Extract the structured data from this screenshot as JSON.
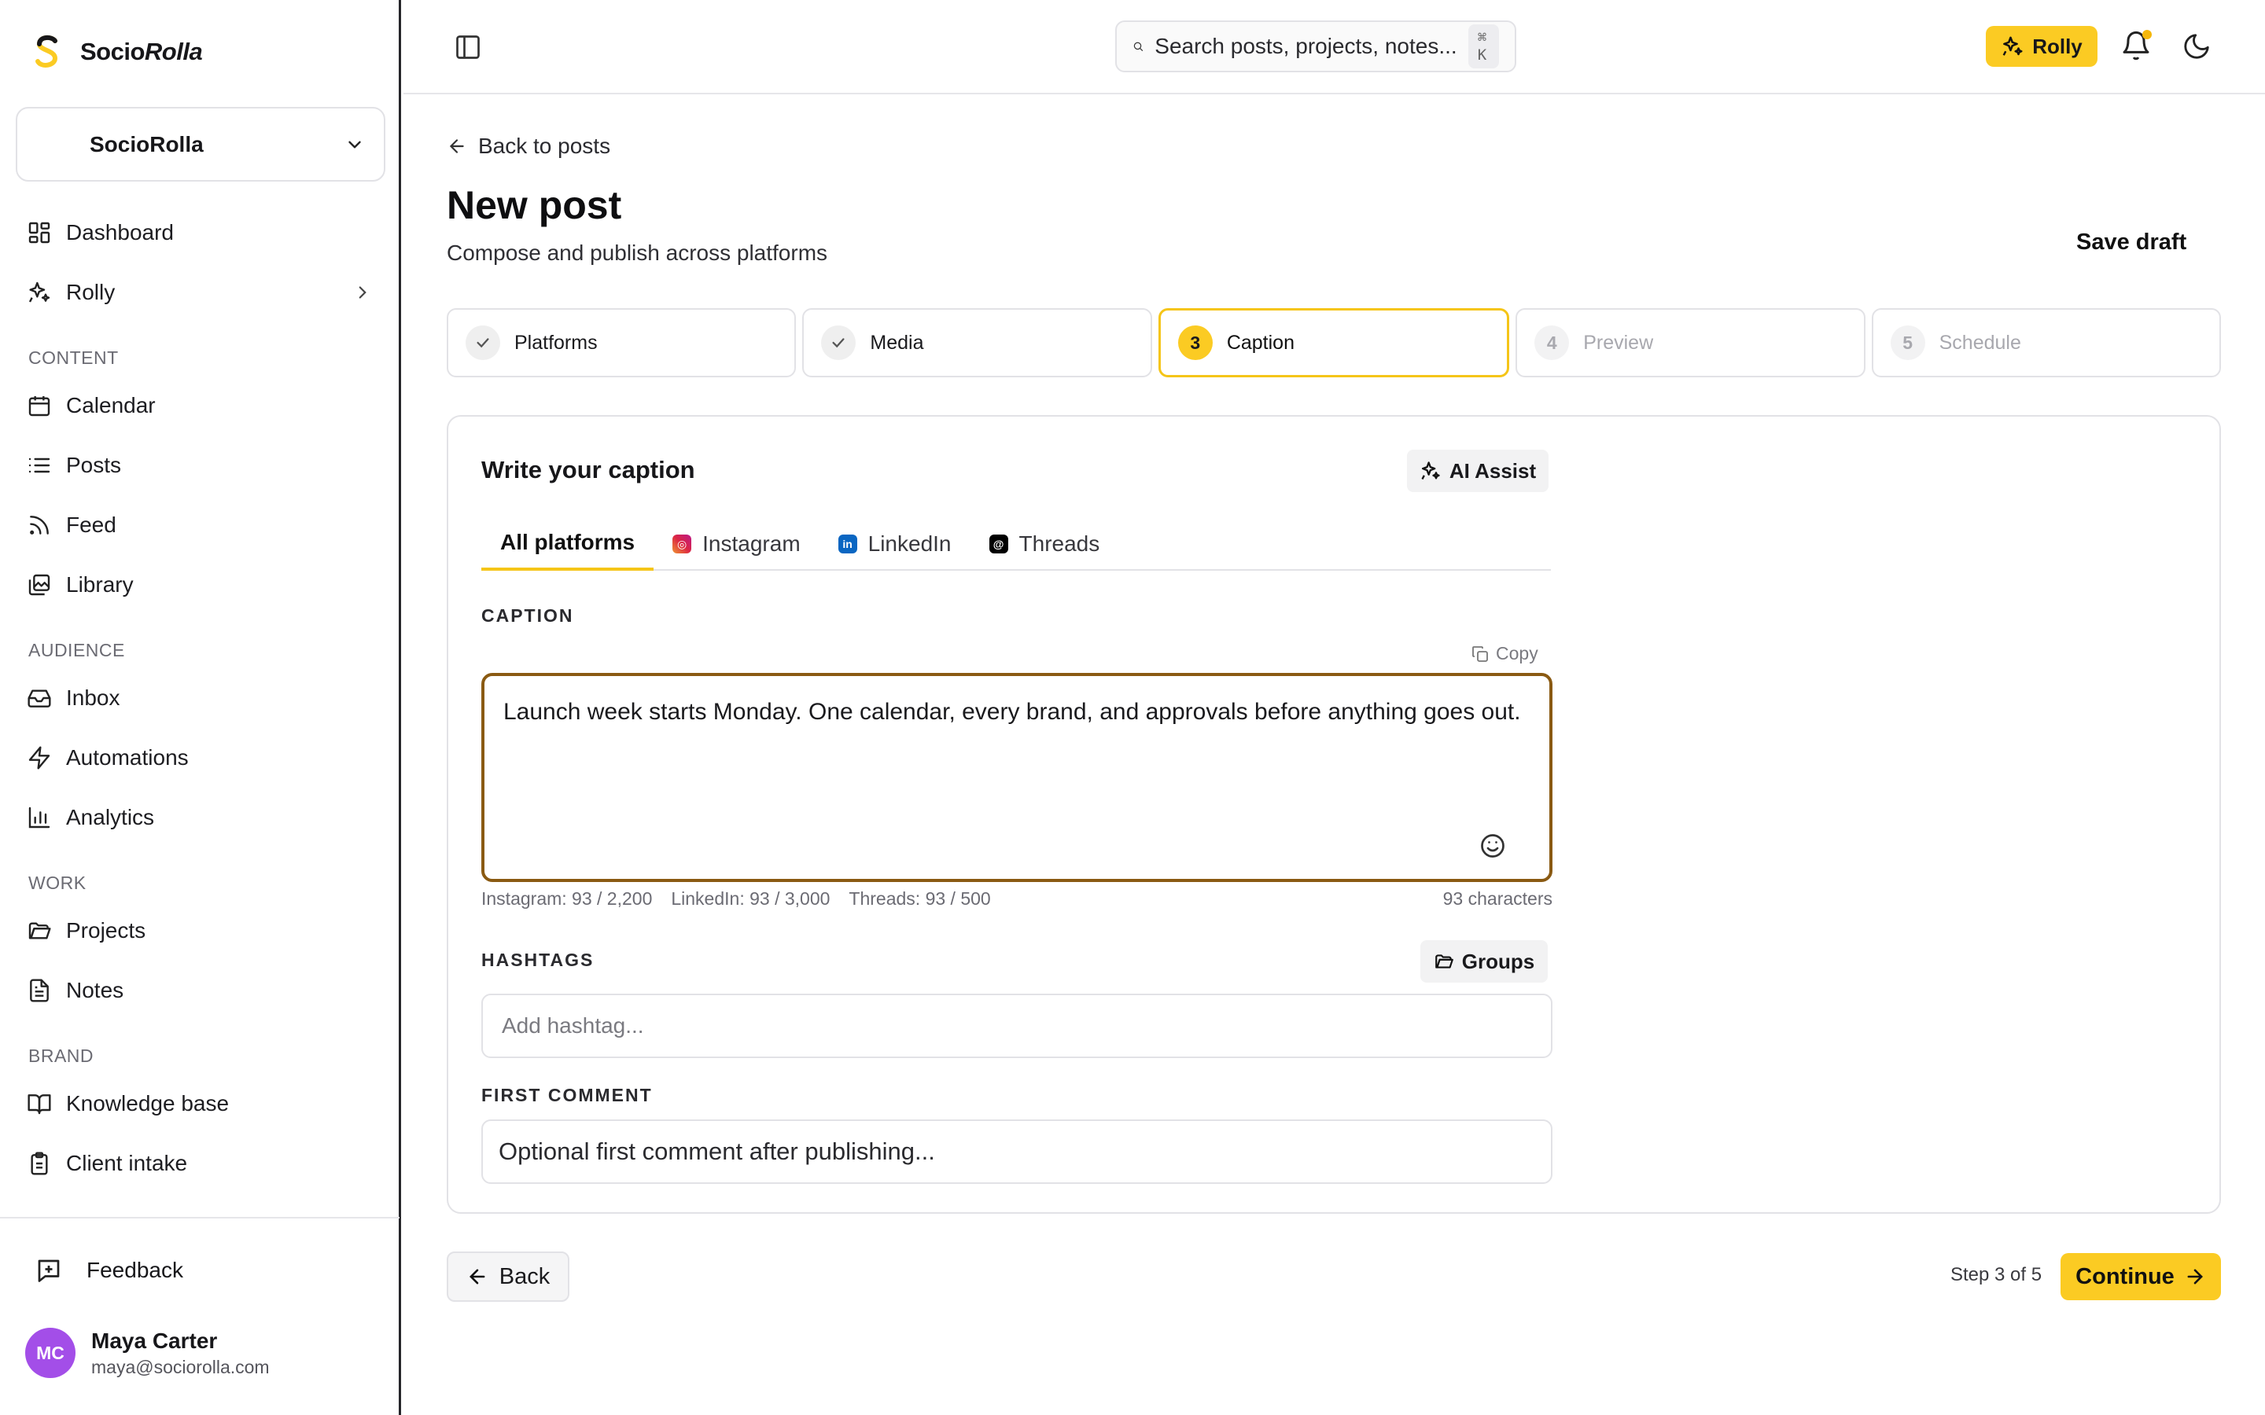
{
  "brand": {
    "name_plain": "Socio",
    "name_italic": "Rolla",
    "accent": "#fbcb23"
  },
  "workspace": {
    "name": "SocioRolla"
  },
  "nav": {
    "dashboard": "Dashboard",
    "rolly": "Rolly",
    "section_content": "CONTENT",
    "calendar": "Calendar",
    "posts": "Posts",
    "feed": "Feed",
    "library": "Library",
    "section_audience": "AUDIENCE",
    "inbox": "Inbox",
    "automations": "Automations",
    "analytics": "Analytics",
    "section_work": "WORK",
    "projects": "Projects",
    "notes": "Notes",
    "section_brand": "BRAND",
    "knowledge_base": "Knowledge base",
    "client_intake": "Client intake"
  },
  "feedback": "Feedback",
  "user": {
    "initials": "MC",
    "name": "Maya Carter",
    "email": "maya@sociorolla.com"
  },
  "topbar": {
    "search_placeholder": "Search posts, projects, notes...",
    "search_shortcut": "⌘ K",
    "rolly_button": "Rolly"
  },
  "page": {
    "back_link": "Back to posts",
    "title": "New post",
    "subtitle": "Compose and publish across platforms",
    "save_draft": "Save draft"
  },
  "steps": [
    {
      "num": "1",
      "label": "Platforms",
      "state": "done"
    },
    {
      "num": "2",
      "label": "Media",
      "state": "done"
    },
    {
      "num": "3",
      "label": "Caption",
      "state": "active"
    },
    {
      "num": "4",
      "label": "Preview",
      "state": "todo"
    },
    {
      "num": "5",
      "label": "Schedule",
      "state": "todo"
    }
  ],
  "caption_card": {
    "title": "Write your caption",
    "ai_assist": "AI Assist",
    "tabs": [
      "All platforms",
      "Instagram",
      "LinkedIn",
      "Threads"
    ],
    "caption_label": "CAPTION",
    "copy": "Copy",
    "caption_text": "Launch week starts Monday. One calendar, every brand, and approvals before anything goes out.",
    "counts": {
      "instagram": "Instagram: 93 / 2,200",
      "linkedin": "LinkedIn: 93 / 3,000",
      "threads": "Threads: 93 / 500",
      "total": "93 characters"
    },
    "hashtags_label": "HASHTAGS",
    "groups": "Groups",
    "hashtag_placeholder": "Add hashtag...",
    "first_comment_label": "FIRST COMMENT",
    "first_comment_placeholder": "Optional first comment after publishing..."
  },
  "footer": {
    "back": "Back",
    "step_count": "Step 3 of 5",
    "continue": "Continue"
  }
}
